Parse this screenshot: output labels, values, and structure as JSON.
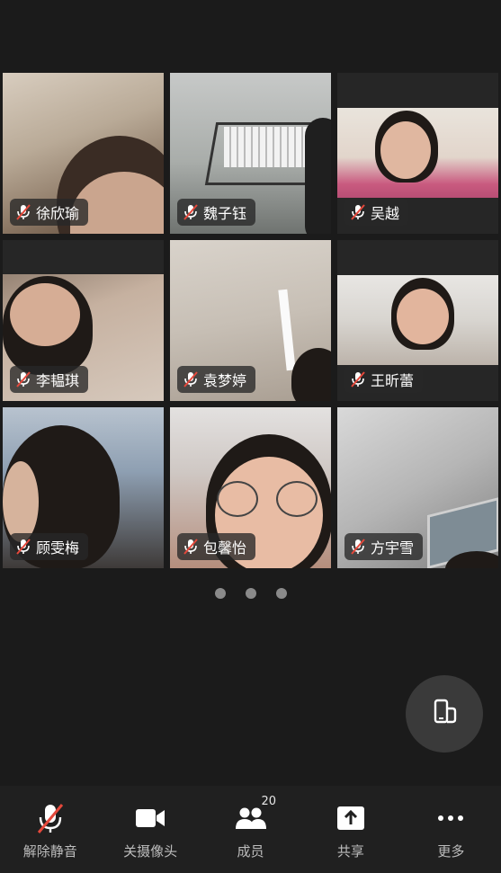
{
  "participants": [
    {
      "name": "徐欣瑜",
      "muted": true
    },
    {
      "name": "魏子钰",
      "muted": true
    },
    {
      "name": "吴越",
      "muted": true
    },
    {
      "name": "李韫琪",
      "muted": true
    },
    {
      "name": "袁梦婷",
      "muted": true
    },
    {
      "name": "王昕蕾",
      "muted": true
    },
    {
      "name": "顾雯梅",
      "muted": true
    },
    {
      "name": "包馨怡",
      "muted": true
    },
    {
      "name": "方宇雪",
      "muted": true
    }
  ],
  "pagination": {
    "pages": 3,
    "current": 1
  },
  "toolbar": {
    "unmute_label": "解除静音",
    "camera_label": "关摄像头",
    "members_label": "成员",
    "members_count": "20",
    "share_label": "共享",
    "more_label": "更多"
  },
  "colors": {
    "mute_red": "#e5483b",
    "background": "#1b1b1b",
    "toolbar": "#202020"
  },
  "icons": {
    "floating": "phone-switch-icon",
    "unmute": "muted-mic-icon",
    "camera": "video-camera-icon",
    "members": "people-icon",
    "share": "share-upload-icon",
    "more": "more-dots-icon"
  }
}
